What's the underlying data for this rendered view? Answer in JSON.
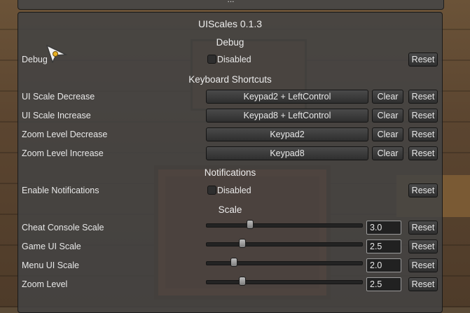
{
  "top_panel": {
    "ellipsis": "..."
  },
  "window": {
    "title": "UIScales 0.1.3"
  },
  "sections": {
    "debug": {
      "heading": "Debug",
      "label": "Debug",
      "toggle_label": "Disabled",
      "reset_label": "Reset"
    },
    "keyboard": {
      "heading": "Keyboard Shortcuts",
      "rows": [
        {
          "label": "UI Scale Decrease",
          "binding": "Keypad2 + LeftControl",
          "clear": "Clear",
          "reset": "Reset"
        },
        {
          "label": "UI Scale Increase",
          "binding": "Keypad8 + LeftControl",
          "clear": "Clear",
          "reset": "Reset"
        },
        {
          "label": "Zoom Level Decrease",
          "binding": "Keypad2",
          "clear": "Clear",
          "reset": "Reset"
        },
        {
          "label": "Zoom Level Increase",
          "binding": "Keypad8",
          "clear": "Clear",
          "reset": "Reset"
        }
      ]
    },
    "notifications": {
      "heading": "Notifications",
      "label": "Enable Notifications",
      "toggle_label": "Disabled",
      "reset_label": "Reset"
    },
    "scale": {
      "heading": "Scale",
      "rows": [
        {
          "label": "Cheat Console Scale",
          "value": "3.0",
          "slider_fraction": 0.28,
          "reset": "Reset"
        },
        {
          "label": "Game UI Scale",
          "value": "2.5",
          "slider_fraction": 0.23,
          "reset": "Reset"
        },
        {
          "label": "Menu UI Scale",
          "value": "2.0",
          "slider_fraction": 0.18,
          "reset": "Reset"
        },
        {
          "label": "Zoom Level",
          "value": "2.5",
          "slider_fraction": 0.23,
          "reset": "Reset"
        }
      ]
    }
  },
  "icons": {
    "cursor": "pointer-cursor-icon",
    "checkbox": "checkbox-icon"
  },
  "colors": {
    "panel": "#444444",
    "button": "#3a3a3a",
    "text": "#e6e6e6"
  }
}
